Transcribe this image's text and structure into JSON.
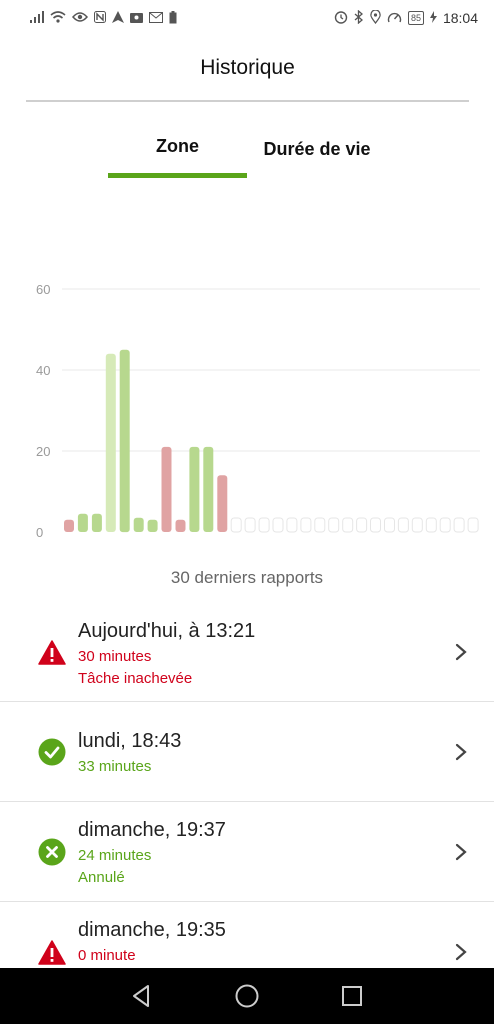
{
  "status_bar": {
    "left_icons": [
      "signal-icon",
      "wifi-icon",
      "eye-icon",
      "nfc-icon",
      "navigation-icon",
      "location-share-icon",
      "mail-icon",
      "battery-saver-icon"
    ],
    "right_icons": [
      "alarm-icon",
      "bluetooth-icon",
      "location-icon",
      "speed-icon"
    ],
    "battery": "85",
    "time": "18:04"
  },
  "header": {
    "title": "Historique"
  },
  "tabs": [
    {
      "label": "Zone",
      "active": true
    },
    {
      "label": "Durée de vie",
      "active": false
    }
  ],
  "colors": {
    "green_accent": "#5aa51a",
    "green_bar": "#b7d88e",
    "green_bar_light": "#d6eab8",
    "red_bar": "#e0a3a3",
    "empty_bar": "#e6e6e6",
    "red_text": "#d0021b",
    "green_text": "#5aa51a",
    "grid": "#e8e8e8",
    "tick": "#9a9a9a"
  },
  "chart_data": {
    "type": "bar",
    "ylim": [
      0,
      60
    ],
    "yticks": [
      0,
      20,
      40,
      60
    ],
    "grid": true,
    "categories": [
      "1",
      "2",
      "3",
      "4",
      "5",
      "6",
      "7",
      "8",
      "9",
      "10",
      "11",
      "12",
      "13",
      "14",
      "15",
      "16",
      "17",
      "18",
      "19",
      "20",
      "21",
      "22",
      "23",
      "24",
      "25",
      "26",
      "27",
      "28",
      "29",
      "30"
    ],
    "values": [
      3,
      4.5,
      4.5,
      44,
      45,
      3.5,
      3,
      21,
      3,
      21,
      21,
      14,
      0,
      0,
      0,
      0,
      0,
      0,
      0,
      0,
      0,
      0,
      0,
      0,
      0,
      0,
      0,
      0,
      0,
      0
    ],
    "status": [
      "red",
      "green",
      "green",
      "green_light",
      "green",
      "green",
      "green",
      "red",
      "red",
      "green",
      "green",
      "red",
      "empty",
      "empty",
      "empty",
      "empty",
      "empty",
      "empty",
      "empty",
      "empty",
      "empty",
      "empty",
      "empty",
      "empty",
      "empty",
      "empty",
      "empty",
      "empty",
      "empty",
      "empty"
    ]
  },
  "chart_caption": "30 derniers rapports",
  "history": [
    {
      "title": "Aujourd'hui, à 13:21",
      "duration": "30 minutes",
      "status": "Tâche inachevée",
      "icon": "warning-icon",
      "color": "red"
    },
    {
      "title": "lundi, 18:43",
      "duration": "33 minutes",
      "status": "",
      "icon": "check-circle-icon",
      "color": "green"
    },
    {
      "title": "dimanche, 19:37",
      "duration": "24 minutes",
      "status": "Annulé",
      "icon": "cancel-circle-icon",
      "color": "green"
    },
    {
      "title": "dimanche, 19:35",
      "duration": "0 minute",
      "status": "",
      "icon": "warning-icon",
      "color": "red"
    }
  ],
  "nav_bar": {
    "buttons": [
      "back-icon",
      "home-icon",
      "recents-icon"
    ]
  }
}
